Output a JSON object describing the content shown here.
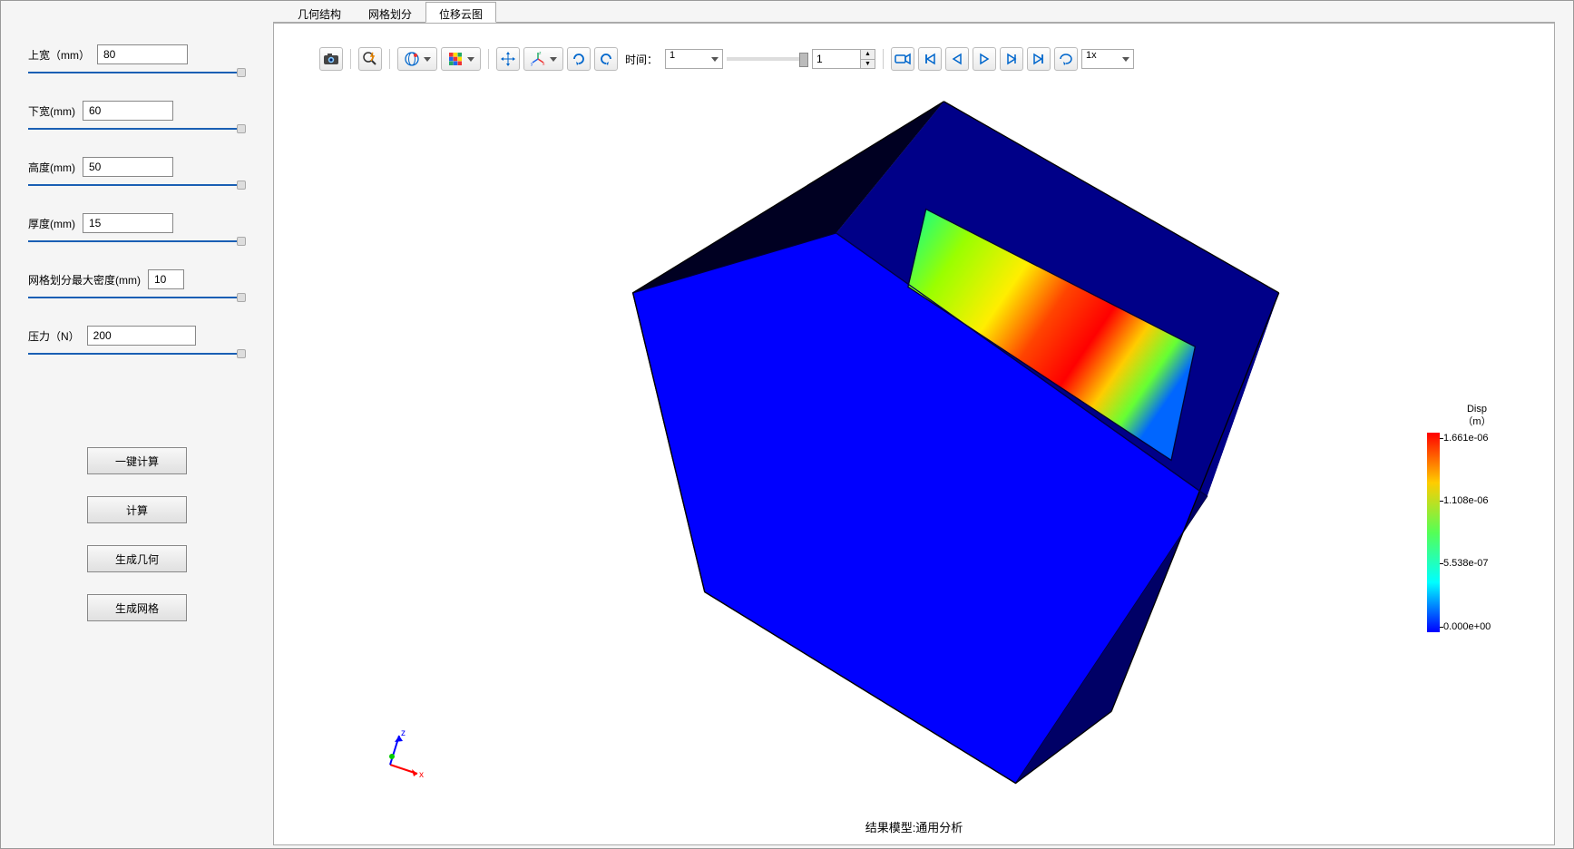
{
  "tabs": [
    {
      "label": "几何结构",
      "active": false
    },
    {
      "label": "网格划分",
      "active": false
    },
    {
      "label": "位移云图",
      "active": true
    }
  ],
  "params": {
    "top_width": {
      "label": "上宽（mm）",
      "value": "80",
      "input_width": 100
    },
    "bottom_width": {
      "label": "下宽(mm)",
      "value": "60",
      "input_width": 100
    },
    "height": {
      "label": "高度(mm)",
      "value": "50",
      "input_width": 100
    },
    "thickness": {
      "label": "厚度(mm)",
      "value": "15",
      "input_width": 100
    },
    "mesh_max": {
      "label": "网格划分最大密度(mm)",
      "value": "10",
      "input_width": 40
    },
    "pressure": {
      "label": "压力（N）",
      "value": "200",
      "input_width": 120
    }
  },
  "buttons": {
    "one_click_calc": "一键计算",
    "calc": "计算",
    "gen_geometry": "生成几何",
    "gen_mesh": "生成网格"
  },
  "toolbar": {
    "time_label": "时间：",
    "time_dropdown": "1",
    "frame_value": "1",
    "speed": "1x"
  },
  "viewport": {
    "caption": "结果模型:通用分析",
    "axes": {
      "x": "x",
      "z": "z"
    }
  },
  "chart_data": {
    "type": "colormap_legend",
    "title_line1": "Disp",
    "title_line2": "（m）",
    "ticks": [
      "1.661e-06",
      "1.108e-06",
      "5.538e-07",
      "0.000e+00"
    ],
    "colormap": [
      "#ff0000",
      "#ffcc00",
      "#55ff55",
      "#00ffff",
      "#0000ff"
    ],
    "range": [
      0.0,
      1.661e-06
    ]
  }
}
